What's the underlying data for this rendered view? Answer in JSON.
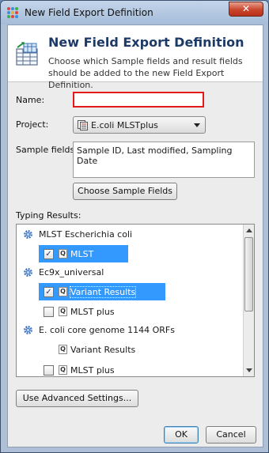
{
  "window": {
    "title": "New Field Export Definition",
    "close_label": "✕"
  },
  "header": {
    "title": "New Field Export Definition",
    "description": "Choose which Sample fields and result fields should be added to the new Field Export Definition."
  },
  "form": {
    "name_label": "Name:",
    "name_value": "",
    "project_label": "Project:",
    "project_value": "E.coli MLSTplus",
    "sample_fields_label": "Sample fields:",
    "sample_fields_value": "Sample ID, Last modified, Sampling Date",
    "choose_button_label": "Choose Sample Fields"
  },
  "typing": {
    "label": "Typing Results:",
    "groups": [
      {
        "name": "MLST Escherichia coli",
        "items": [
          {
            "label": "MLST",
            "checked": true,
            "selected": true
          }
        ]
      },
      {
        "name": "Ec9x_universal",
        "items": [
          {
            "label": "Variant Results",
            "checked": true,
            "selected": true
          },
          {
            "label": "MLST plus",
            "checked": false,
            "selected": false
          }
        ]
      },
      {
        "name": "E. coli core genome 1144 ORFs",
        "items": [
          {
            "label": "Variant Results",
            "checked": null,
            "selected": false
          },
          {
            "label": "MLST plus",
            "checked": false,
            "selected": false
          }
        ]
      }
    ]
  },
  "buttons": {
    "advanced_label": "Use Advanced Settings...",
    "ok_label": "OK",
    "cancel_label": "Cancel"
  },
  "glyphs": {
    "check": "✓",
    "q": "Q"
  },
  "colors": {
    "selection": "#3399ff",
    "header_title": "#1d3a66",
    "error_border": "#e11a1a"
  }
}
